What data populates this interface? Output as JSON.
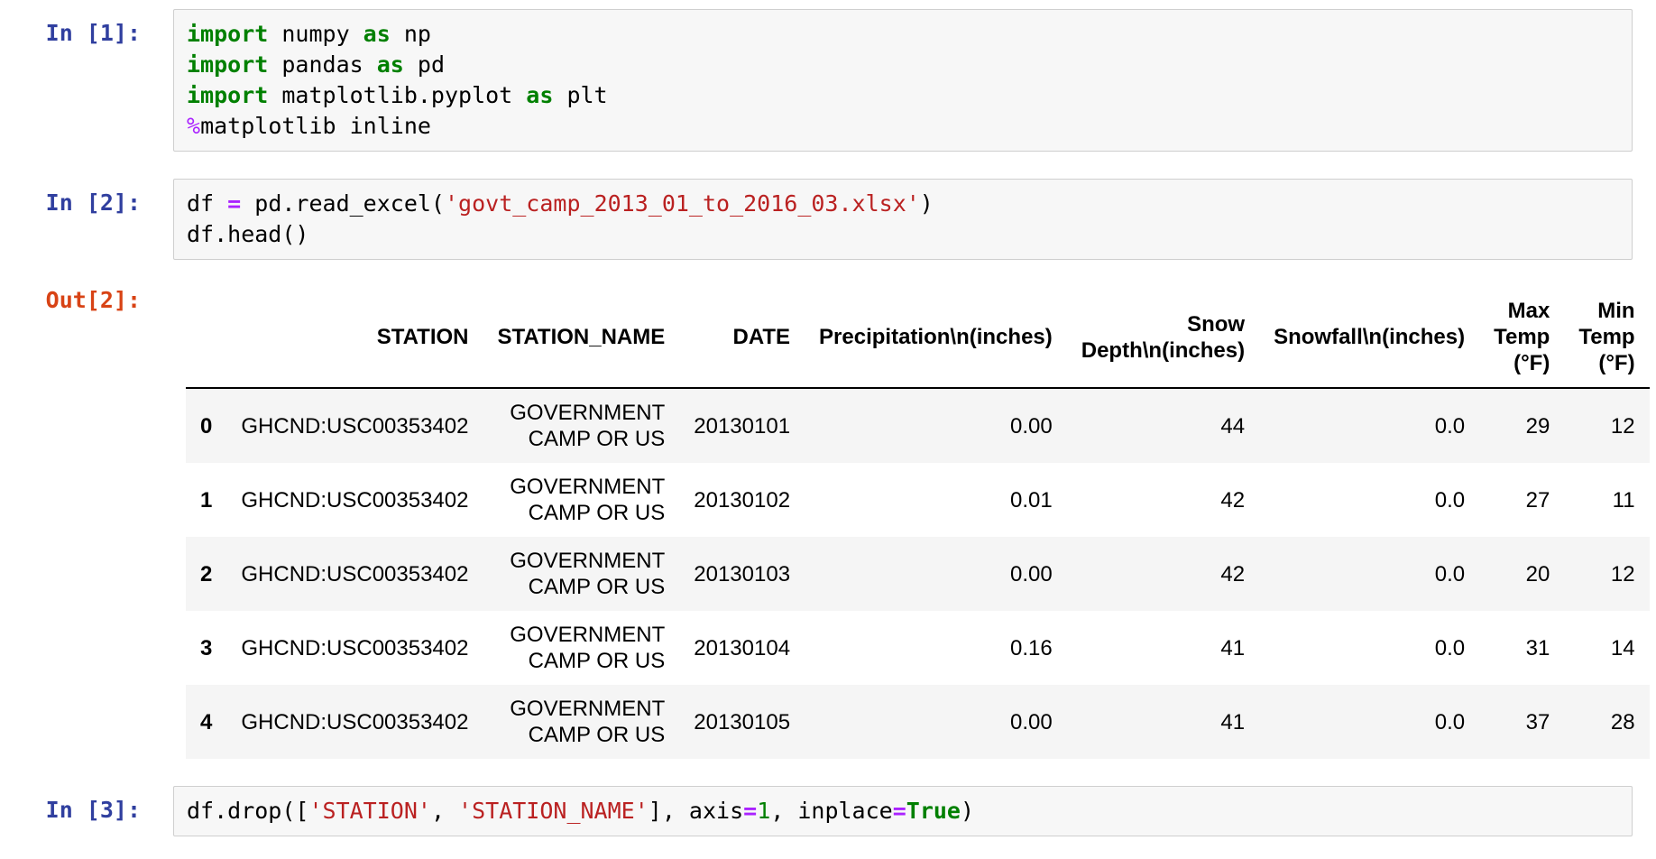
{
  "app": "jupyter-notebook",
  "colors": {
    "input_prompt": "#303F9F",
    "output_prompt": "#D84315",
    "cell_background": "#f7f7f7",
    "cell_border": "#cfcfcf",
    "keyword": "#008000",
    "operator": "#AA22FF",
    "string": "#BA2121",
    "number": "#008000",
    "stripe": "#f5f5f5"
  },
  "cells": [
    {
      "kind": "code",
      "prompt": "In [1]:",
      "code": [
        [
          [
            "kw",
            "import"
          ],
          [
            "pl",
            " numpy "
          ],
          [
            "kw",
            "as"
          ],
          [
            "pl",
            " np"
          ]
        ],
        [
          [
            "kw",
            "import"
          ],
          [
            "pl",
            " pandas "
          ],
          [
            "kw",
            "as"
          ],
          [
            "pl",
            " pd"
          ]
        ],
        [
          [
            "kw",
            "import"
          ],
          [
            "pl",
            " matplotlib.pyplot "
          ],
          [
            "kw",
            "as"
          ],
          [
            "pl",
            " plt"
          ]
        ],
        [
          [
            "mg",
            "%"
          ],
          [
            "pl",
            "matplotlib inline"
          ]
        ]
      ]
    },
    {
      "kind": "code",
      "prompt": "In [2]:",
      "code": [
        [
          [
            "pl",
            "df "
          ],
          [
            "op",
            "="
          ],
          [
            "pl",
            " pd.read_excel("
          ],
          [
            "st",
            "'govt_camp_2013_01_to_2016_03.xlsx'"
          ],
          [
            "pl",
            ")"
          ]
        ],
        [
          [
            "pl",
            "df.head()"
          ]
        ]
      ]
    },
    {
      "kind": "output",
      "prompt": "Out[2]:",
      "table": {
        "columns": [
          "",
          "STATION",
          "STATION_NAME",
          "DATE",
          "Precipitation\\n(inches)",
          "Snow\nDepth\\n(inches)",
          "Snowfall\\n(inches)",
          "Max\nTemp\n(°F)",
          "Min\nTemp\n(°F)"
        ],
        "rows": [
          [
            "0",
            "GHCND:USC00353402",
            "GOVERNMENT\nCAMP OR US",
            "20130101",
            "0.00",
            "44",
            "0.0",
            "29",
            "12"
          ],
          [
            "1",
            "GHCND:USC00353402",
            "GOVERNMENT\nCAMP OR US",
            "20130102",
            "0.01",
            "42",
            "0.0",
            "27",
            "11"
          ],
          [
            "2",
            "GHCND:USC00353402",
            "GOVERNMENT\nCAMP OR US",
            "20130103",
            "0.00",
            "42",
            "0.0",
            "20",
            "12"
          ],
          [
            "3",
            "GHCND:USC00353402",
            "GOVERNMENT\nCAMP OR US",
            "20130104",
            "0.16",
            "41",
            "0.0",
            "31",
            "14"
          ],
          [
            "4",
            "GHCND:USC00353402",
            "GOVERNMENT\nCAMP OR US",
            "20130105",
            "0.00",
            "41",
            "0.0",
            "37",
            "28"
          ]
        ]
      }
    },
    {
      "kind": "code",
      "prompt": "In [3]:",
      "code": [
        [
          [
            "pl",
            "df.drop(["
          ],
          [
            "st",
            "'STATION'"
          ],
          [
            "pl",
            ", "
          ],
          [
            "st",
            "'STATION_NAME'"
          ],
          [
            "pl",
            "], axis"
          ],
          [
            "op",
            "="
          ],
          [
            "nm",
            "1"
          ],
          [
            "pl",
            ", inplace"
          ],
          [
            "op",
            "="
          ],
          [
            "kw",
            "True"
          ],
          [
            "pl",
            ")"
          ]
        ]
      ]
    }
  ]
}
